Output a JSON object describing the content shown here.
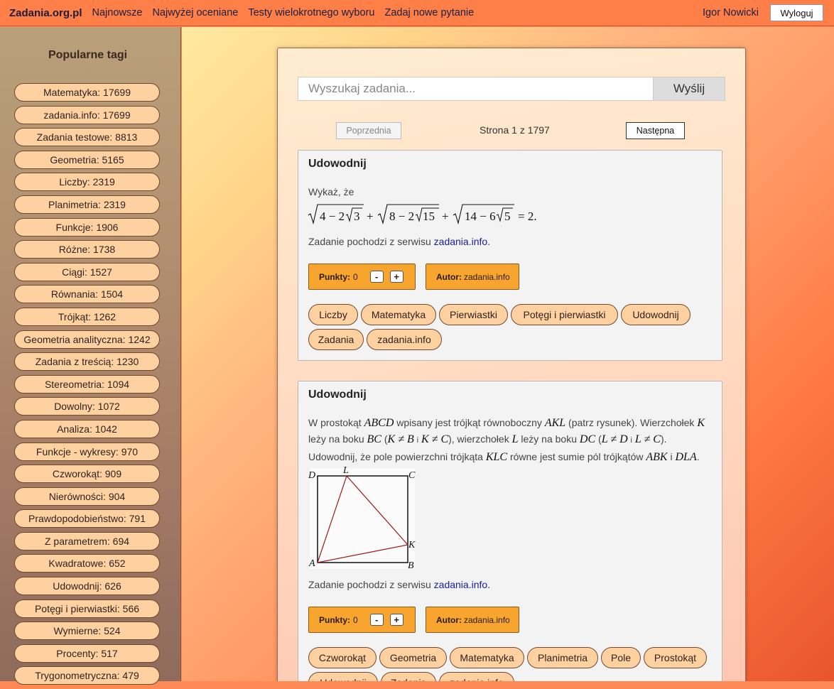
{
  "nav": {
    "brand": "Zadania.org.pl",
    "links": [
      "Najnowsze",
      "Najwyżej oceniane",
      "Testy wielokrotnego wyboru",
      "Zadaj nowe pytanie"
    ],
    "user": "Igor Nowicki",
    "logout": "Wyloguj"
  },
  "sidebar": {
    "title": "Popularne tagi",
    "tags": [
      "Matematyka: 17699",
      "zadania.info: 17699",
      "Zadania testowe: 8813",
      "Geometria: 5165",
      "Liczby: 2319",
      "Planimetria: 2319",
      "Funkcje: 1906",
      "Różne: 1738",
      "Ciągi: 1527",
      "Równania: 1504",
      "Trójkąt: 1262",
      "Geometria analityczna: 1242",
      "Zadania z treścią: 1230",
      "Stereometria: 1094",
      "Dowolny: 1072",
      "Analiza: 1042",
      "Funkcje - wykresy: 970",
      "Czworokąt: 909",
      "Nierówności: 904",
      "Prawdopodobieństwo: 791",
      "Z parametrem: 694",
      "Kwadratowe: 652",
      "Udowodnij: 626",
      "Potęgi i pierwiastki: 566",
      "Wymierne: 524",
      "Procenty: 517",
      "Trygonometryczna: 479"
    ]
  },
  "search": {
    "placeholder": "Wyszukaj zadania...",
    "button": "Wyślij"
  },
  "pager": {
    "prev": "Poprzednia",
    "info": "Strona 1 z 1797",
    "next": "Następna"
  },
  "cards": [
    {
      "title": "Udowodnij",
      "intro": "Wykaż, że",
      "formula": "√(4 − 2√3) + √(8 − 2√15) + √(14 − 6√5) = 2.",
      "source_prefix": "Zadanie pochodzi z serwisu",
      "source_link": "zadania.info.",
      "points_label": "Punkty:",
      "points_value": "0",
      "minus": "-",
      "plus": "+",
      "author_label": "Autor:",
      "author_value": "zadania.info",
      "tags": [
        "Liczby",
        "Matematyka",
        "Pierwiastki",
        "Potęgi i pierwiastki",
        "Udowodnij",
        "Zadania",
        "zadania.info"
      ]
    },
    {
      "title": "Udowodnij",
      "text": {
        "t1": "W prostokąt",
        "m1": "ABCD",
        "t2": "wpisany jest trójkąt równoboczny",
        "m2": "AKL",
        "t3": "(patrz rysunek). Wierzchołek",
        "m3": "K",
        "t4": "leży na boku",
        "m4": "BC",
        "t5": "(",
        "m5": "K ≠ B",
        "t6": "i",
        "m6": "K ≠ C",
        "t7": "), wierzchołek",
        "m7": "L",
        "t8": "leży na boku",
        "m8": "DC",
        "t9": "(",
        "m9": "L ≠ D",
        "t10": "i",
        "m10": "L ≠ C",
        "t11": ").",
        "t12": "Udowodnij, że pole powierzchni trójkąta",
        "m11": "KLC",
        "t13": "równe jest sumie pól trójkątów",
        "m12": "ABK",
        "t14": "i",
        "m13": "DLA",
        "t15": "."
      },
      "figure_labels": {
        "D": "D",
        "L": "L",
        "C": "C",
        "K": "K",
        "A": "A",
        "B": "B"
      },
      "source_prefix": "Zadanie pochodzi z serwisu",
      "source_link": "zadania.info.",
      "points_label": "Punkty:",
      "points_value": "0",
      "minus": "-",
      "plus": "+",
      "author_label": "Autor:",
      "author_value": "zadania.info",
      "tags": [
        "Czworokąt",
        "Geometria",
        "Matematyka",
        "Planimetria",
        "Pole",
        "Prostokąt",
        "Udowodnij",
        "Zadania",
        "zadania.info"
      ]
    }
  ]
}
